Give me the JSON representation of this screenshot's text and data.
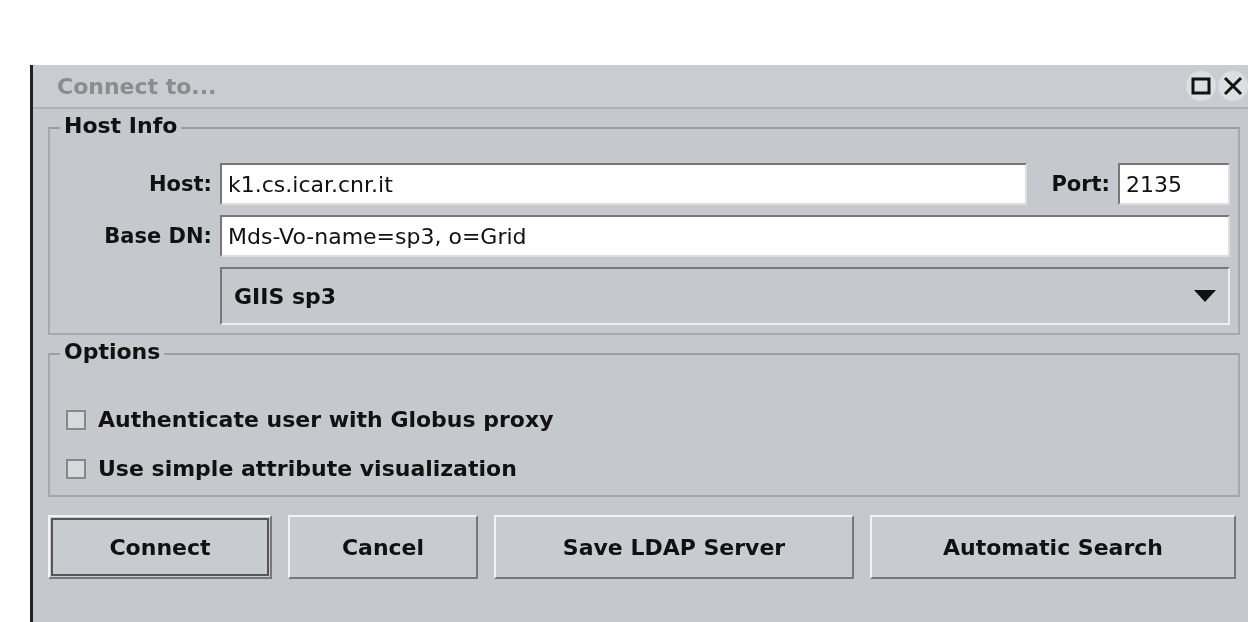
{
  "window": {
    "title": "Connect to..."
  },
  "host_info": {
    "title": "Host Info",
    "host_label": "Host:",
    "host": "k1.cs.icar.cnr.it",
    "port_label": "Port:",
    "port": "2135",
    "base_dn_label": "Base DN:",
    "base_dn": "Mds-Vo-name=sp3, o=Grid",
    "server": "GIIS sp3"
  },
  "options": {
    "title": "Options",
    "items": [
      {
        "label": "Authenticate user with Globus proxy",
        "checked": false
      },
      {
        "label": "Use simple attribute visualization",
        "checked": false
      }
    ]
  },
  "buttons": [
    {
      "label": "Connect",
      "default": true
    },
    {
      "label": "Cancel",
      "default": false
    },
    {
      "label": "Save LDAP Server",
      "default": false
    },
    {
      "label": "Automatic Search",
      "default": false
    }
  ]
}
